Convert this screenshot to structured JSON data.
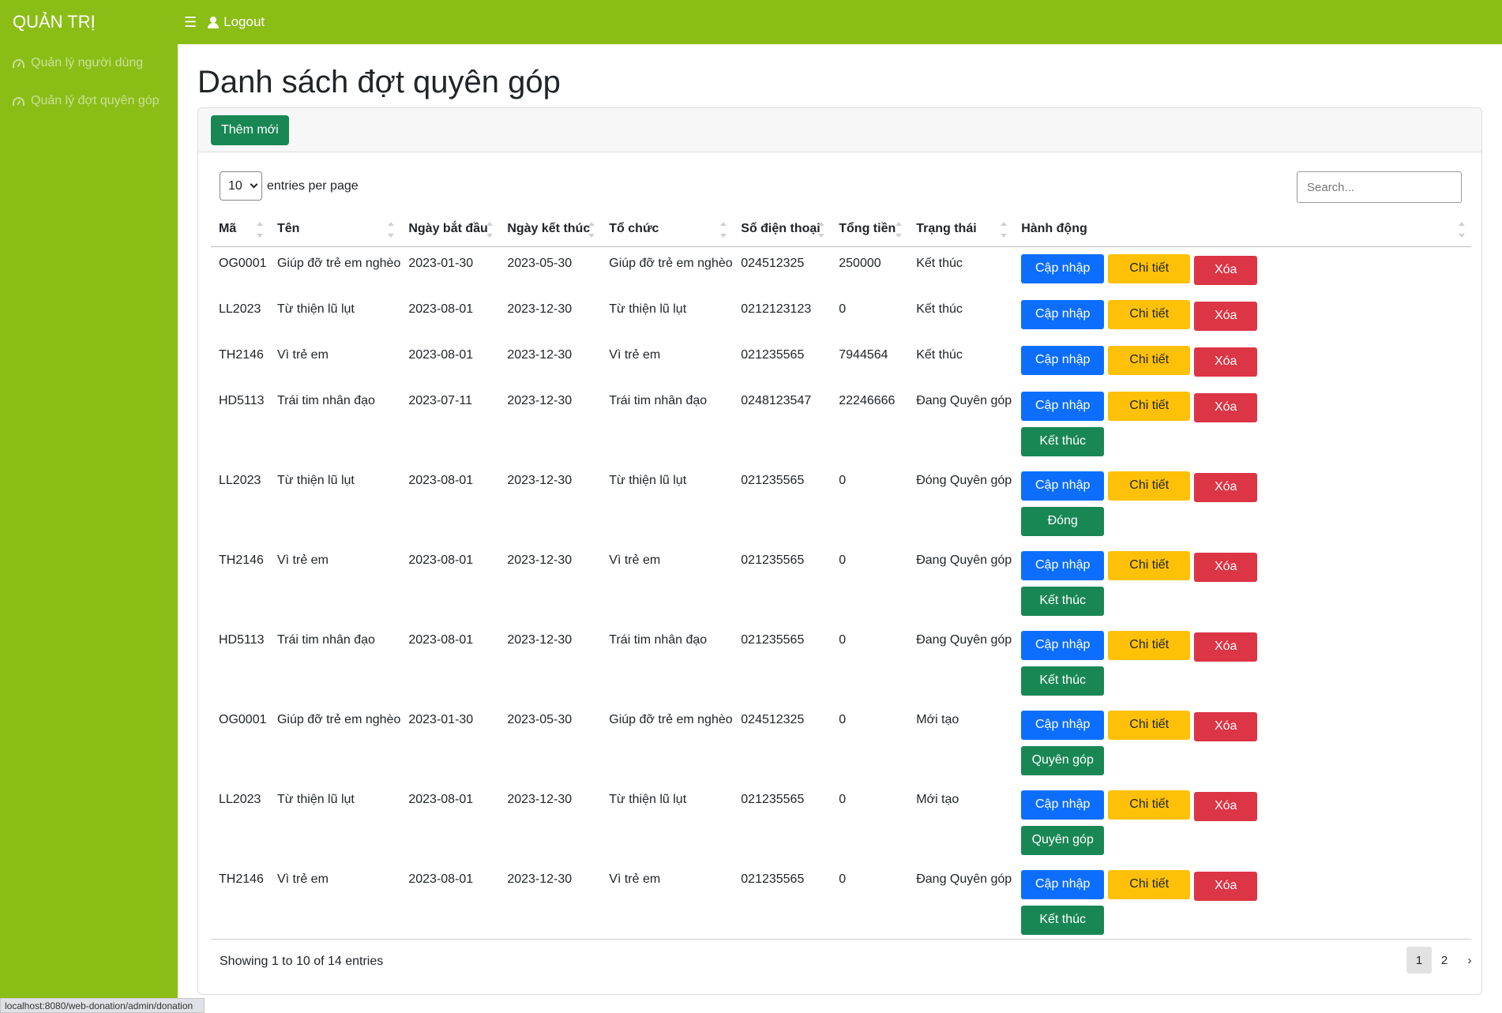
{
  "app": {
    "brand": "QUẢN TRỊ",
    "logout_label": "Logout"
  },
  "sidebar": {
    "items": [
      {
        "label": "Quản lý người dùng",
        "icon": "dashboard-gauge-icon"
      },
      {
        "label": "Quản lý đợt quyên góp",
        "icon": "dashboard-gauge-icon"
      }
    ]
  },
  "page": {
    "title": "Danh sách đợt quyên góp"
  },
  "toolbar": {
    "add_label": "Thêm mới"
  },
  "per_page": {
    "value": "10",
    "label": "entries per page"
  },
  "search": {
    "placeholder": "Search..."
  },
  "table": {
    "columns": [
      "Mã",
      "Tên",
      "Ngày bắt đầu",
      "Ngày kết thúc",
      "Tổ chức",
      "Số điện thoại",
      "Tổng tiền",
      "Trạng thái",
      "Hành động"
    ],
    "action_labels": {
      "edit": "Cập nhập",
      "detail": "Chi tiết",
      "delete": "Xóa"
    },
    "rows": [
      {
        "ma": "OG0001",
        "ten": "Giúp đỡ trẻ em nghèo",
        "bat_dau": "2023-01-30",
        "ket_thuc": "2023-05-30",
        "to_chuc": "Giúp đỡ trẻ em nghèo",
        "sdt": "024512325",
        "tong_tien": "250000",
        "trang_thai": "Kết thúc",
        "extra": ""
      },
      {
        "ma": "LL2023",
        "ten": "Từ thiện lũ lụt",
        "bat_dau": "2023-08-01",
        "ket_thuc": "2023-12-30",
        "to_chuc": "Từ thiện lũ lụt",
        "sdt": "0212123123",
        "tong_tien": "0",
        "trang_thai": "Kết thúc",
        "extra": ""
      },
      {
        "ma": "TH2146",
        "ten": "Vì trẻ em",
        "bat_dau": "2023-08-01",
        "ket_thuc": "2023-12-30",
        "to_chuc": "Vì trẻ em",
        "sdt": "021235565",
        "tong_tien": "7944564",
        "trang_thai": "Kết thúc",
        "extra": ""
      },
      {
        "ma": "HD5113",
        "ten": "Trái tim nhân đạo",
        "bat_dau": "2023-07-11",
        "ket_thuc": "2023-12-30",
        "to_chuc": "Trái tim nhân đạo",
        "sdt": "0248123547",
        "tong_tien": "22246666",
        "trang_thai": "Đang Quyên góp",
        "extra": "Kết thúc"
      },
      {
        "ma": "LL2023",
        "ten": "Từ thiện lũ lụt",
        "bat_dau": "2023-08-01",
        "ket_thuc": "2023-12-30",
        "to_chuc": "Từ thiện lũ lụt",
        "sdt": "021235565",
        "tong_tien": "0",
        "trang_thai": "Đóng Quyên góp",
        "extra": "Đóng"
      },
      {
        "ma": "TH2146",
        "ten": "Vì trẻ em",
        "bat_dau": "2023-08-01",
        "ket_thuc": "2023-12-30",
        "to_chuc": "Vì trẻ em",
        "sdt": "021235565",
        "tong_tien": "0",
        "trang_thai": "Đang Quyên góp",
        "extra": "Kết thúc"
      },
      {
        "ma": "HD5113",
        "ten": "Trái tim nhân đạo",
        "bat_dau": "2023-08-01",
        "ket_thuc": "2023-12-30",
        "to_chuc": "Trái tim nhân đạo",
        "sdt": "021235565",
        "tong_tien": "0",
        "trang_thai": "Đang Quyên góp",
        "extra": "Kết thúc"
      },
      {
        "ma": "OG0001",
        "ten": "Giúp đỡ trẻ em nghèo",
        "bat_dau": "2023-01-30",
        "ket_thuc": "2023-05-30",
        "to_chuc": "Giúp đỡ trẻ em nghèo",
        "sdt": "024512325",
        "tong_tien": "0",
        "trang_thai": "Mới tạo",
        "extra": "Quyên góp"
      },
      {
        "ma": "LL2023",
        "ten": "Từ thiện lũ lụt",
        "bat_dau": "2023-08-01",
        "ket_thuc": "2023-12-30",
        "to_chuc": "Từ thiện lũ lụt",
        "sdt": "021235565",
        "tong_tien": "0",
        "trang_thai": "Mới tạo",
        "extra": "Quyên góp"
      },
      {
        "ma": "TH2146",
        "ten": "Vì trẻ em",
        "bat_dau": "2023-08-01",
        "ket_thuc": "2023-12-30",
        "to_chuc": "Vì trẻ em",
        "sdt": "021235565",
        "tong_tien": "0",
        "trang_thai": "Đang Quyên góp",
        "extra": "Kết thúc"
      }
    ]
  },
  "footer": {
    "showing": "Showing 1 to 10 of 14 entries",
    "pages": [
      "1",
      "2"
    ],
    "next_label": "›",
    "active_page": "1"
  },
  "status_bar": {
    "url": "localhost:8080/web-donation/admin/donation"
  },
  "colors": {
    "brand_green": "#8bbd17",
    "primary": "#0d6efd",
    "warning": "#ffc107",
    "danger": "#dc3545",
    "success": "#198754"
  }
}
